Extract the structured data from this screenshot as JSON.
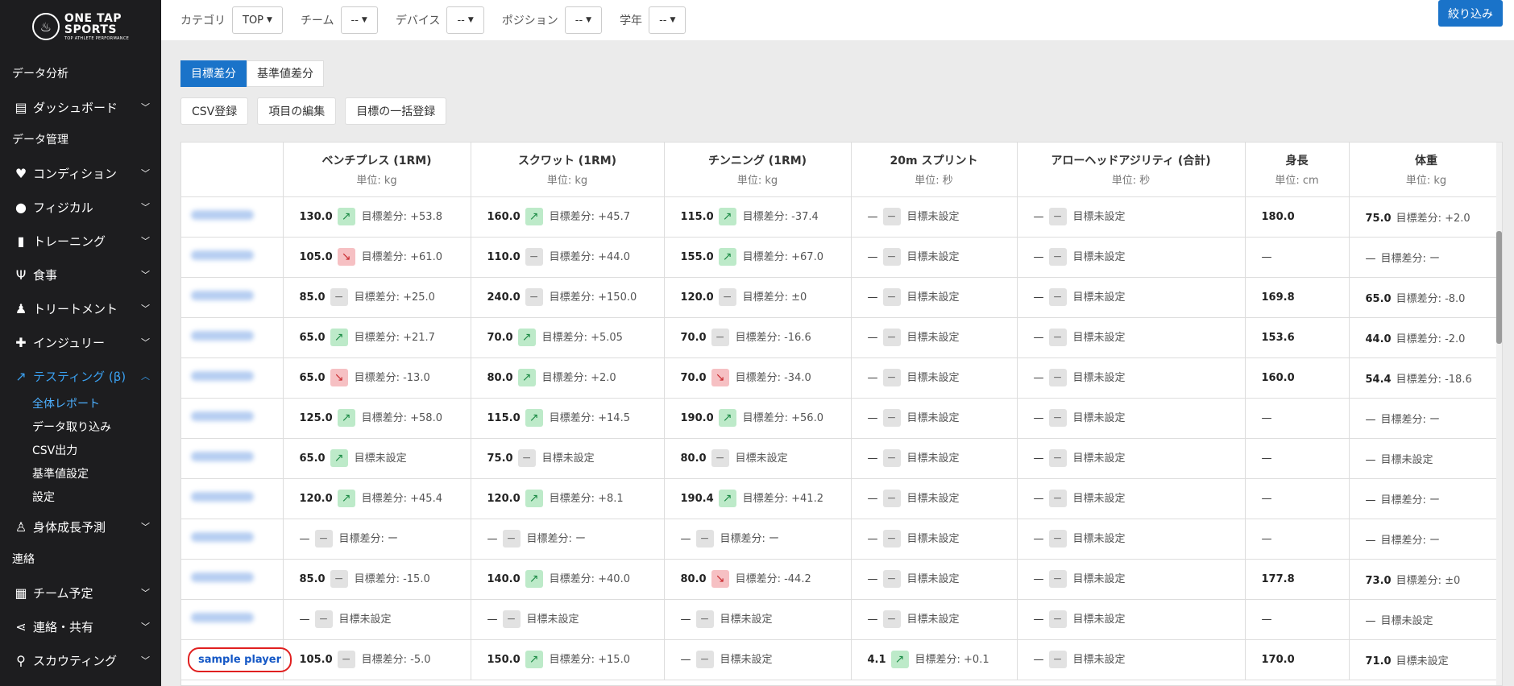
{
  "sidebar": {
    "logo_line1": "ONE TAP",
    "logo_line2": "SPORTS",
    "logo_sub": "TOP ATHLETE PERFORMANCE",
    "nav": [
      {
        "type": "section",
        "label": "データ分析"
      },
      {
        "type": "item",
        "label": "ダッシュボード",
        "icon": "id-card-icon",
        "glyph": "▤",
        "chevron": "down"
      },
      {
        "type": "section",
        "label": "データ管理"
      },
      {
        "type": "item",
        "label": "コンディション",
        "icon": "heartbeat-icon",
        "glyph": "♥",
        "chevron": "down"
      },
      {
        "type": "item",
        "label": "フィジカル",
        "icon": "user-circle-icon",
        "glyph": "●",
        "chevron": "down"
      },
      {
        "type": "item",
        "label": "トレーニング",
        "icon": "dumbbell-icon",
        "glyph": "▮",
        "chevron": "down"
      },
      {
        "type": "item",
        "label": "食事",
        "icon": "utensils-icon",
        "glyph": "Ψ",
        "chevron": "down"
      },
      {
        "type": "item",
        "label": "トリートメント",
        "icon": "user-md-icon",
        "glyph": "♟",
        "chevron": "down"
      },
      {
        "type": "item",
        "label": "インジュリー",
        "icon": "medkit-icon",
        "glyph": "✚",
        "chevron": "down"
      },
      {
        "type": "item",
        "label": "テスティング (β)",
        "icon": "chart-line-icon",
        "glyph": "↗",
        "chevron": "up",
        "active": true,
        "sub": [
          {
            "label": "全体レポート",
            "active": true
          },
          {
            "label": "データ取り込み"
          },
          {
            "label": "CSV出力"
          },
          {
            "label": "基準値設定"
          },
          {
            "label": "設定"
          }
        ]
      },
      {
        "type": "item",
        "label": "身体成長予測",
        "icon": "child-icon",
        "glyph": "♙",
        "chevron": "down"
      },
      {
        "type": "section",
        "label": "連絡"
      },
      {
        "type": "item",
        "label": "チーム予定",
        "icon": "calendar-icon",
        "glyph": "▦",
        "chevron": "down"
      },
      {
        "type": "item",
        "label": "連絡・共有",
        "icon": "share-icon",
        "glyph": "⋖",
        "chevron": "down"
      },
      {
        "type": "item",
        "label": "スカウティング",
        "icon": "search-icon",
        "glyph": "⚲",
        "chevron": "down"
      }
    ]
  },
  "filters": [
    {
      "label": "カテゴリ",
      "value": "TOP"
    },
    {
      "label": "チーム",
      "value": "--"
    },
    {
      "label": "デバイス",
      "value": "--"
    },
    {
      "label": "ポジション",
      "value": "--"
    },
    {
      "label": "学年",
      "value": "--"
    }
  ],
  "apply_label": "絞り込み",
  "tabs": [
    {
      "label": "目標差分",
      "active": true
    },
    {
      "label": "基準値差分",
      "active": false
    }
  ],
  "actions": [
    "CSV登録",
    "項目の編集",
    "目標の一括登録"
  ],
  "columns": [
    {
      "name": "ベンチプレス (1RM)",
      "unit": "単位: kg"
    },
    {
      "name": "スクワット (1RM)",
      "unit": "単位: kg"
    },
    {
      "name": "チンニング (1RM)",
      "unit": "単位: kg"
    },
    {
      "name": "20m スプリント",
      "unit": "単位: 秒"
    },
    {
      "name": "アローヘッドアジリティ (合計)",
      "unit": "単位: 秒"
    },
    {
      "name": "身長",
      "unit": "単位: cm"
    },
    {
      "name": "体重",
      "unit": "単位: kg"
    }
  ],
  "rows": [
    {
      "name": "",
      "cells": [
        {
          "v": "130.0",
          "t": "up",
          "d": "目標差分: +53.8"
        },
        {
          "v": "160.0",
          "t": "up",
          "d": "目標差分: +45.7"
        },
        {
          "v": "115.0",
          "t": "up",
          "d": "目標差分: -37.4"
        },
        {
          "v": "",
          "t": "flat",
          "d": "目標未設定"
        },
        {
          "v": "",
          "t": "flat",
          "d": "目標未設定"
        },
        {
          "v": "180.0"
        },
        {
          "v": "75.0",
          "d": "目標差分: +2.0"
        }
      ]
    },
    {
      "name": "",
      "cells": [
        {
          "v": "105.0",
          "t": "down",
          "d": "目標差分: +61.0"
        },
        {
          "v": "110.0",
          "t": "flat",
          "d": "目標差分: +44.0"
        },
        {
          "v": "155.0",
          "t": "up",
          "d": "目標差分: +67.0"
        },
        {
          "v": "",
          "t": "flat",
          "d": "目標未設定"
        },
        {
          "v": "",
          "t": "flat",
          "d": "目標未設定"
        },
        {
          "v": ""
        },
        {
          "v": "",
          "d": "目標差分: ー"
        }
      ]
    },
    {
      "name": "",
      "cells": [
        {
          "v": "85.0",
          "t": "flat",
          "d": "目標差分: +25.0"
        },
        {
          "v": "240.0",
          "t": "flat",
          "d": "目標差分: +150.0"
        },
        {
          "v": "120.0",
          "t": "flat",
          "d": "目標差分: ±0"
        },
        {
          "v": "",
          "t": "flat",
          "d": "目標未設定"
        },
        {
          "v": "",
          "t": "flat",
          "d": "目標未設定"
        },
        {
          "v": "169.8"
        },
        {
          "v": "65.0",
          "d": "目標差分: -8.0"
        }
      ]
    },
    {
      "name": "",
      "cells": [
        {
          "v": "65.0",
          "t": "up",
          "d": "目標差分: +21.7"
        },
        {
          "v": "70.0",
          "t": "up",
          "d": "目標差分: +5.05"
        },
        {
          "v": "70.0",
          "t": "flat",
          "d": "目標差分: -16.6"
        },
        {
          "v": "",
          "t": "flat",
          "d": "目標未設定"
        },
        {
          "v": "",
          "t": "flat",
          "d": "目標未設定"
        },
        {
          "v": "153.6"
        },
        {
          "v": "44.0",
          "d": "目標差分: -2.0"
        }
      ]
    },
    {
      "name": "",
      "cells": [
        {
          "v": "65.0",
          "t": "down",
          "d": "目標差分: -13.0"
        },
        {
          "v": "80.0",
          "t": "up",
          "d": "目標差分: +2.0"
        },
        {
          "v": "70.0",
          "t": "down",
          "d": "目標差分: -34.0"
        },
        {
          "v": "",
          "t": "flat",
          "d": "目標未設定"
        },
        {
          "v": "",
          "t": "flat",
          "d": "目標未設定"
        },
        {
          "v": "160.0"
        },
        {
          "v": "54.4",
          "d": "目標差分: -18.6"
        }
      ]
    },
    {
      "name": "",
      "cells": [
        {
          "v": "125.0",
          "t": "up",
          "d": "目標差分: +58.0"
        },
        {
          "v": "115.0",
          "t": "up",
          "d": "目標差分: +14.5"
        },
        {
          "v": "190.0",
          "t": "up",
          "d": "目標差分: +56.0"
        },
        {
          "v": "",
          "t": "flat",
          "d": "目標未設定"
        },
        {
          "v": "",
          "t": "flat",
          "d": "目標未設定"
        },
        {
          "v": ""
        },
        {
          "v": "",
          "d": "目標差分: ー"
        }
      ]
    },
    {
      "name": "",
      "cells": [
        {
          "v": "65.0",
          "t": "up",
          "d": "目標未設定"
        },
        {
          "v": "75.0",
          "t": "flat",
          "d": "目標未設定"
        },
        {
          "v": "80.0",
          "t": "flat",
          "d": "目標未設定"
        },
        {
          "v": "",
          "t": "flat",
          "d": "目標未設定"
        },
        {
          "v": "",
          "t": "flat",
          "d": "目標未設定"
        },
        {
          "v": ""
        },
        {
          "v": "",
          "d": "目標未設定"
        }
      ]
    },
    {
      "name": "",
      "cells": [
        {
          "v": "120.0",
          "t": "up",
          "d": "目標差分: +45.4"
        },
        {
          "v": "120.0",
          "t": "up",
          "d": "目標差分: +8.1"
        },
        {
          "v": "190.4",
          "t": "up",
          "d": "目標差分: +41.2"
        },
        {
          "v": "",
          "t": "flat",
          "d": "目標未設定"
        },
        {
          "v": "",
          "t": "flat",
          "d": "目標未設定"
        },
        {
          "v": ""
        },
        {
          "v": "",
          "d": "目標差分: ー"
        }
      ]
    },
    {
      "name": "",
      "cells": [
        {
          "v": "",
          "t": "flat",
          "d": "目標差分: ー"
        },
        {
          "v": "",
          "t": "flat",
          "d": "目標差分: ー"
        },
        {
          "v": "",
          "t": "flat",
          "d": "目標差分: ー"
        },
        {
          "v": "",
          "t": "flat",
          "d": "目標未設定"
        },
        {
          "v": "",
          "t": "flat",
          "d": "目標未設定"
        },
        {
          "v": ""
        },
        {
          "v": "",
          "d": "目標差分: ー"
        }
      ]
    },
    {
      "name": "",
      "cells": [
        {
          "v": "85.0",
          "t": "flat",
          "d": "目標差分: -15.0"
        },
        {
          "v": "140.0",
          "t": "up",
          "d": "目標差分: +40.0"
        },
        {
          "v": "80.0",
          "t": "down",
          "d": "目標差分: -44.2"
        },
        {
          "v": "",
          "t": "flat",
          "d": "目標未設定"
        },
        {
          "v": "",
          "t": "flat",
          "d": "目標未設定"
        },
        {
          "v": "177.8"
        },
        {
          "v": "73.0",
          "d": "目標差分: ±0"
        }
      ]
    },
    {
      "name": "",
      "cells": [
        {
          "v": "",
          "t": "flat",
          "d": "目標未設定"
        },
        {
          "v": "",
          "t": "flat",
          "d": "目標未設定"
        },
        {
          "v": "",
          "t": "flat",
          "d": "目標未設定"
        },
        {
          "v": "",
          "t": "flat",
          "d": "目標未設定"
        },
        {
          "v": "",
          "t": "flat",
          "d": "目標未設定"
        },
        {
          "v": ""
        },
        {
          "v": "",
          "d": "目標未設定"
        }
      ]
    },
    {
      "name": "sample player",
      "highlight": true,
      "cells": [
        {
          "v": "105.0",
          "t": "flat",
          "d": "目標差分: -5.0"
        },
        {
          "v": "150.0",
          "t": "up",
          "d": "目標差分: +15.0"
        },
        {
          "v": "",
          "t": "flat",
          "d": "目標未設定"
        },
        {
          "v": "4.1",
          "t": "up",
          "d": "目標差分: +0.1"
        },
        {
          "v": "",
          "t": "flat",
          "d": "目標未設定"
        },
        {
          "v": "170.0"
        },
        {
          "v": "71.0",
          "d": "目標未設定"
        }
      ]
    }
  ],
  "colors": {
    "accent": "#1a73c9",
    "sidebar_bg": "#1d1d1f",
    "up": "#1c8b45",
    "down": "#c92a2f",
    "highlight_ring": "#e02020"
  }
}
